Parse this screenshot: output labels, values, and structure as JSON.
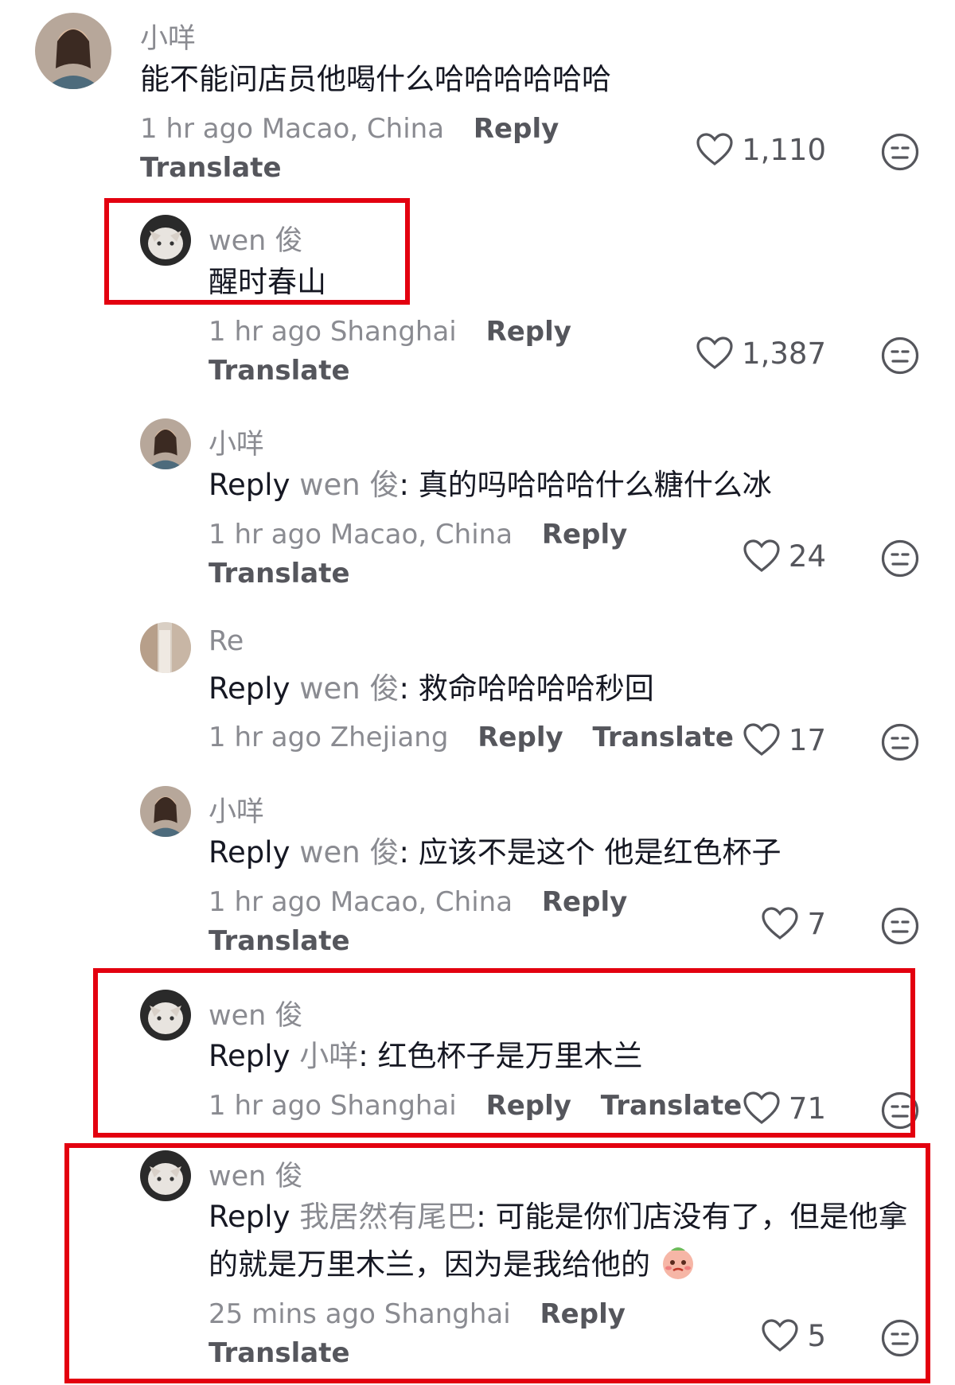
{
  "comments": [
    {
      "username": "小咩",
      "text": "能不能问店员他喝什么哈哈哈哈哈哈",
      "time": "1 hr ago",
      "location": "Macao, China",
      "reply_label": "Reply",
      "translate_label": "Translate",
      "likes": "1,110"
    },
    {
      "username": "wen 俊",
      "text": "醒时春山",
      "time": "1 hr ago",
      "location": "Shanghai",
      "reply_label": "Reply",
      "translate_label": "Translate",
      "likes": "1,387"
    },
    {
      "username": "小咩",
      "reply_prefix": "Reply",
      "reply_to": "wen 俊",
      "text": ": 真的吗哈哈哈什么糖什么冰",
      "time": "1 hr ago",
      "location": "Macao, China",
      "reply_label": "Reply",
      "translate_label": "Translate",
      "likes": "24"
    },
    {
      "username": "Re",
      "reply_prefix": "Reply",
      "reply_to": "wen 俊",
      "text": ": 救命哈哈哈哈秒回",
      "time": "1 hr ago",
      "location": "Zhejiang",
      "reply_label": "Reply",
      "translate_label": "Translate",
      "likes": "17"
    },
    {
      "username": "小咩",
      "reply_prefix": "Reply",
      "reply_to": "wen 俊",
      "text": ": 应该不是这个 他是红色杯子",
      "time": "1 hr ago",
      "location": "Macao, China",
      "reply_label": "Reply",
      "translate_label": "Translate",
      "likes": "7"
    },
    {
      "username": "wen 俊",
      "reply_prefix": "Reply",
      "reply_to": "小咩",
      "text": ": 红色杯子是万里木兰",
      "time": "1 hr ago",
      "location": "Shanghai",
      "reply_label": "Reply",
      "translate_label": "Translate",
      "likes": "71"
    },
    {
      "username": "wen 俊",
      "reply_prefix": "Reply",
      "reply_to": "我居然有尾巴",
      "text": ": 可能是你们店没有了，但是他拿",
      "text_line2": "的就是万里木兰，因为是我给他的",
      "time": "25 mins ago",
      "location": "Shanghai",
      "reply_label": "Reply",
      "translate_label": "Translate",
      "likes": "5"
    }
  ],
  "colors": {
    "highlight_box": "#e3000f",
    "muted_text": "#8a8b91",
    "action_text": "#55565c",
    "primary_text": "#161823"
  },
  "icons": {
    "like": "heart-outline-icon",
    "dislike": "neutral-face-icon",
    "emoji": "pleading-face-sticker"
  }
}
